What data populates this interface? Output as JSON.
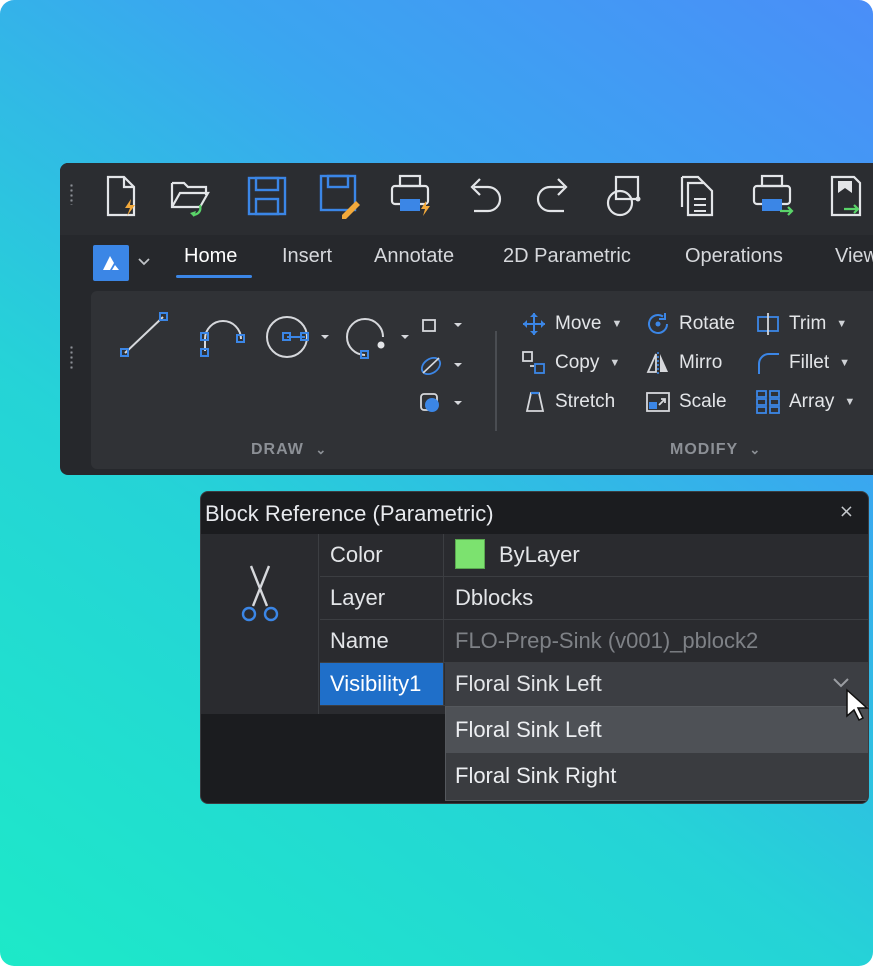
{
  "ribbon": {
    "quick_access": [
      {
        "icon": "new-file-lightning-icon"
      },
      {
        "icon": "open-folder-icon"
      },
      {
        "icon": "save-icon"
      },
      {
        "icon": "save-as-icon"
      },
      {
        "icon": "quick-print-icon"
      },
      {
        "icon": "undo-icon"
      },
      {
        "icon": "redo-icon"
      },
      {
        "icon": "block-insert-icon"
      },
      {
        "icon": "copy-document-icon"
      },
      {
        "icon": "print-export-icon"
      },
      {
        "icon": "export-icon"
      }
    ],
    "tabs": [
      {
        "label": "Home",
        "active": true
      },
      {
        "label": "Insert"
      },
      {
        "label": "Annotate"
      },
      {
        "label": "2D Parametric"
      },
      {
        "label": "Operations"
      },
      {
        "label": "View"
      }
    ],
    "groups": {
      "draw_label": "DRAW",
      "modify_label": "MODIFY"
    },
    "modify": {
      "move": "Move",
      "rotate": "Rotate",
      "trim": "Trim",
      "copy": "Copy",
      "mirror": "Mirro",
      "fillet": "Fillet",
      "stretch": "Stretch",
      "scale": "Scale",
      "array": "Array"
    },
    "colors": {
      "accent": "#3b86e6"
    }
  },
  "properties": {
    "title": "Block Reference (Parametric)",
    "close": "×",
    "rows": {
      "color_key": "Color",
      "color_val": "ByLayer",
      "layer_key": "Layer",
      "layer_val": "Dblocks",
      "name_key": "Name",
      "name_val": "FLO-Prep-Sink (v001)_pblock2",
      "vis_key": "Visibility1",
      "vis_val": "Floral Sink Left"
    },
    "dropdown": [
      "Floral Sink Left",
      "Floral Sink Right"
    ],
    "colors": {
      "swatch": "#7ce26f",
      "selection": "#1f6fc9"
    }
  }
}
